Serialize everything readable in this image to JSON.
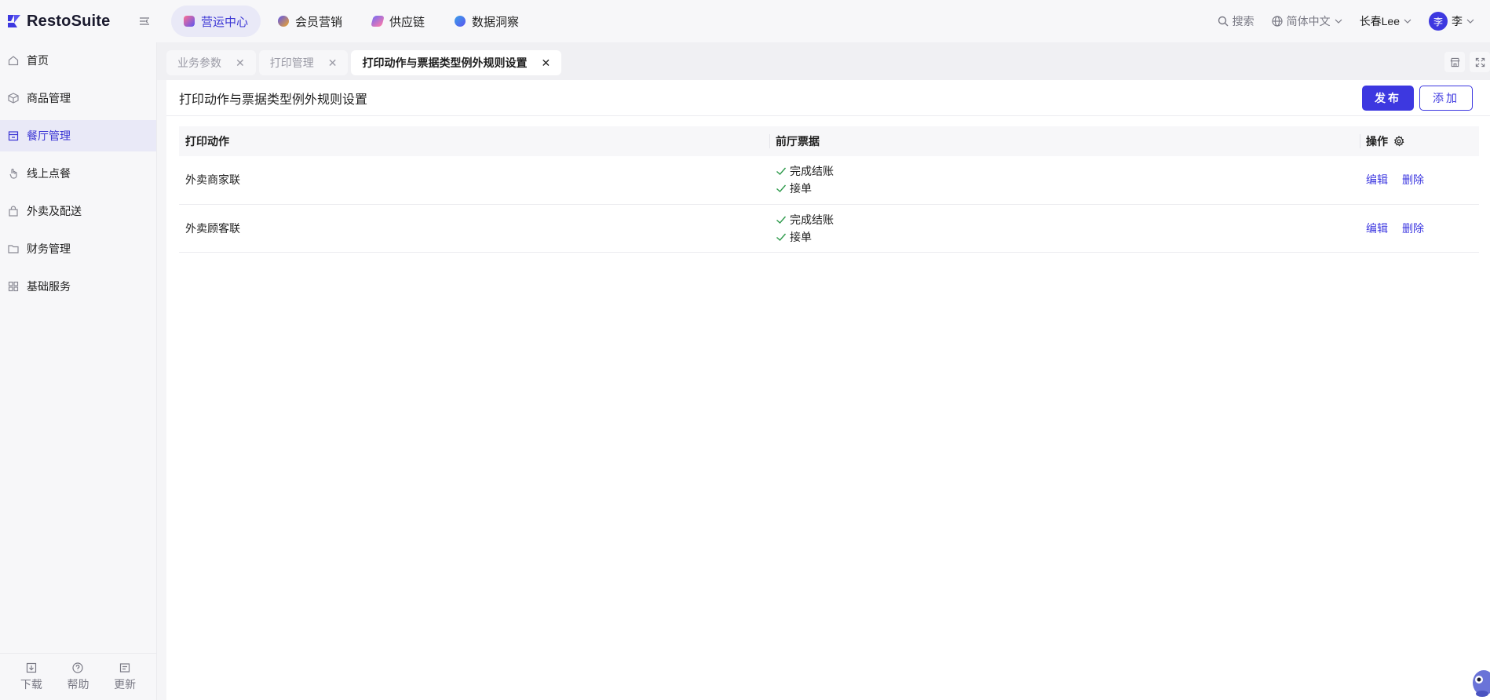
{
  "app": {
    "name": "RestoSuite"
  },
  "topnav": {
    "items": [
      {
        "label": "营运中心",
        "active": true,
        "color": "#5b55f0"
      },
      {
        "label": "会员营销",
        "active": false,
        "color": "#f2a623"
      },
      {
        "label": "供应链",
        "active": false,
        "color": "#7b6cf0"
      },
      {
        "label": "数据洞察",
        "active": false,
        "color": "#3aa0e8"
      }
    ],
    "search_label": "搜索",
    "language": "简体中文",
    "store": "长春Lee",
    "user_avatar": "李",
    "user_name": "李"
  },
  "sidebar": {
    "items": [
      {
        "label": "首页",
        "icon": "home-icon"
      },
      {
        "label": "商品管理",
        "icon": "box-icon"
      },
      {
        "label": "餐厅管理",
        "icon": "store-icon",
        "active": true
      },
      {
        "label": "线上点餐",
        "icon": "tap-icon"
      },
      {
        "label": "外卖及配送",
        "icon": "bag-icon"
      },
      {
        "label": "财务管理",
        "icon": "folder-icon"
      },
      {
        "label": "基础服务",
        "icon": "grid-icon"
      }
    ],
    "footer": {
      "download": "下载",
      "help": "帮助",
      "update": "更新"
    }
  },
  "tabs": [
    {
      "label": "业务参数",
      "active": false
    },
    {
      "label": "打印管理",
      "active": false
    },
    {
      "label": "打印动作与票据类型例外规则设置",
      "active": true
    }
  ],
  "page": {
    "title": "打印动作与票据类型例外规则设置",
    "publish_label": "发布",
    "add_label": "添加"
  },
  "table": {
    "columns": [
      "打印动作",
      "前厅票据",
      "操作"
    ],
    "rows": [
      {
        "action": "外卖商家联",
        "receipts": [
          "完成结账",
          "接单"
        ],
        "edit": "编辑",
        "delete": "删除"
      },
      {
        "action": "外卖顾客联",
        "receipts": [
          "完成结账",
          "接单"
        ],
        "edit": "编辑",
        "delete": "删除"
      }
    ]
  },
  "colors": {
    "accent": "#3d38e0",
    "check": "#2e9a4b"
  }
}
